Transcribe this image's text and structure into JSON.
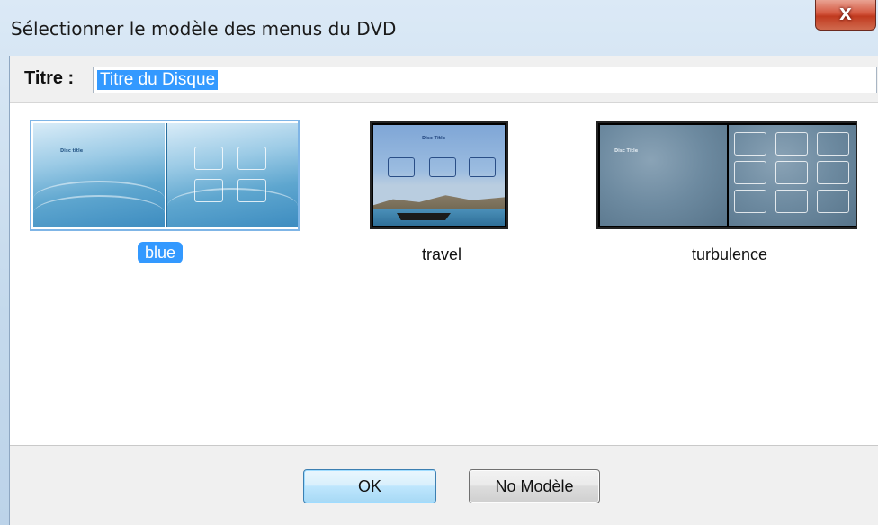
{
  "window": {
    "title": "Sélectionner le modèle des menus du DVD",
    "close_label": "X"
  },
  "title_field": {
    "label": "Titre :",
    "value": "Titre du Disque"
  },
  "templates": [
    {
      "name": "blue",
      "selected": true,
      "mini_title": "Disc title"
    },
    {
      "name": "travel",
      "selected": false,
      "mini_title": "Disc Title"
    },
    {
      "name": "turbulence",
      "selected": false,
      "mini_title": "Disc Title"
    }
  ],
  "buttons": {
    "ok": "OK",
    "no_model": "No Modèle"
  },
  "colors": {
    "selection": "#3399ff",
    "close_button": "#c03a1f"
  }
}
